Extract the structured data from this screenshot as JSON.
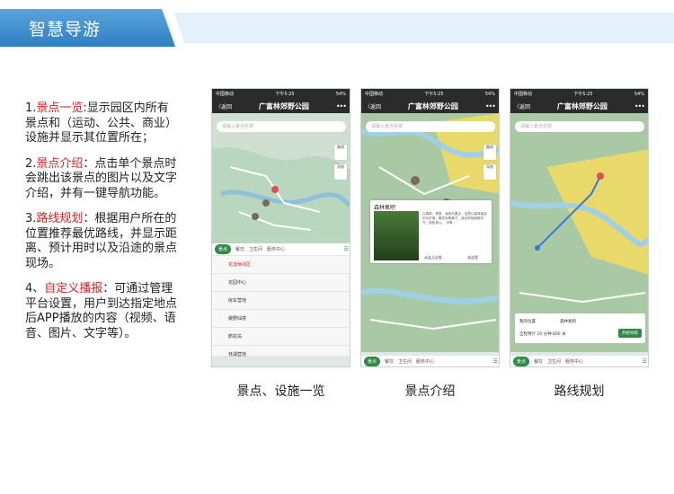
{
  "header": {
    "title": "智慧导游"
  },
  "description": [
    {
      "num": "1.",
      "highlight": "景点一览",
      "text": ":显示园区内所有景点和（运动、公共、商业）设施并显示其位置所在；"
    },
    {
      "num": "2.",
      "highlight": "景点介绍",
      "text": "：点击单个景点时会跳出该景点的图片以及文字介绍，并有一键导航功能。"
    },
    {
      "num": "3.",
      "highlight": "路线规划",
      "text": "：根据用户所在的位置推荐最优路线，并显示距离、预计用时以及沿途的景点现场。"
    },
    {
      "num": "4、",
      "highlight": "自定义播报",
      "text": "：可通过管理平台设置，用户到达指定地点后APP播放的内容（视频、语音、图片、文字等）。"
    }
  ],
  "phone": {
    "status_left": "中国移动",
    "status_time": "下午5:25",
    "status_right": "54%",
    "back": "〈返回",
    "title": "广富林郊野公园",
    "more": "•••",
    "search_placeholder": "请输入景点名称"
  },
  "categories": [
    "景点",
    "餐饮",
    "卫生间",
    "服务中心"
  ],
  "phone1": {
    "side_buttons": [
      "路线",
      "导航"
    ],
    "list": [
      "花漾休闲区",
      "花园中心",
      "房车营地",
      "缓野仙境",
      "鹤花岛",
      "林湖营地"
    ]
  },
  "phone2": {
    "card_name": "森林氧吧",
    "card_text": "以森林、清泉、溪润为要点，这里以森林蔓延的为环境，散发负氧离子，适合呼吸新鲜空气，放松身心。",
    "card_detail": "详情 ›",
    "card_nav": "从这儿出发",
    "card_go": "去这里"
  },
  "phone3": {
    "my_location": "我的位置",
    "destination": "森林氧吧",
    "total_label": "全程预计",
    "total_time": "10 分钟",
    "total_dist": "800 米",
    "go_button": "开始导航"
  },
  "captions": [
    "景点、设施一览",
    "景点介绍",
    "路线规划"
  ],
  "colors": {
    "banner": "#2f7fc4",
    "highlight": "#e02020",
    "accent": "#2e8b45"
  }
}
